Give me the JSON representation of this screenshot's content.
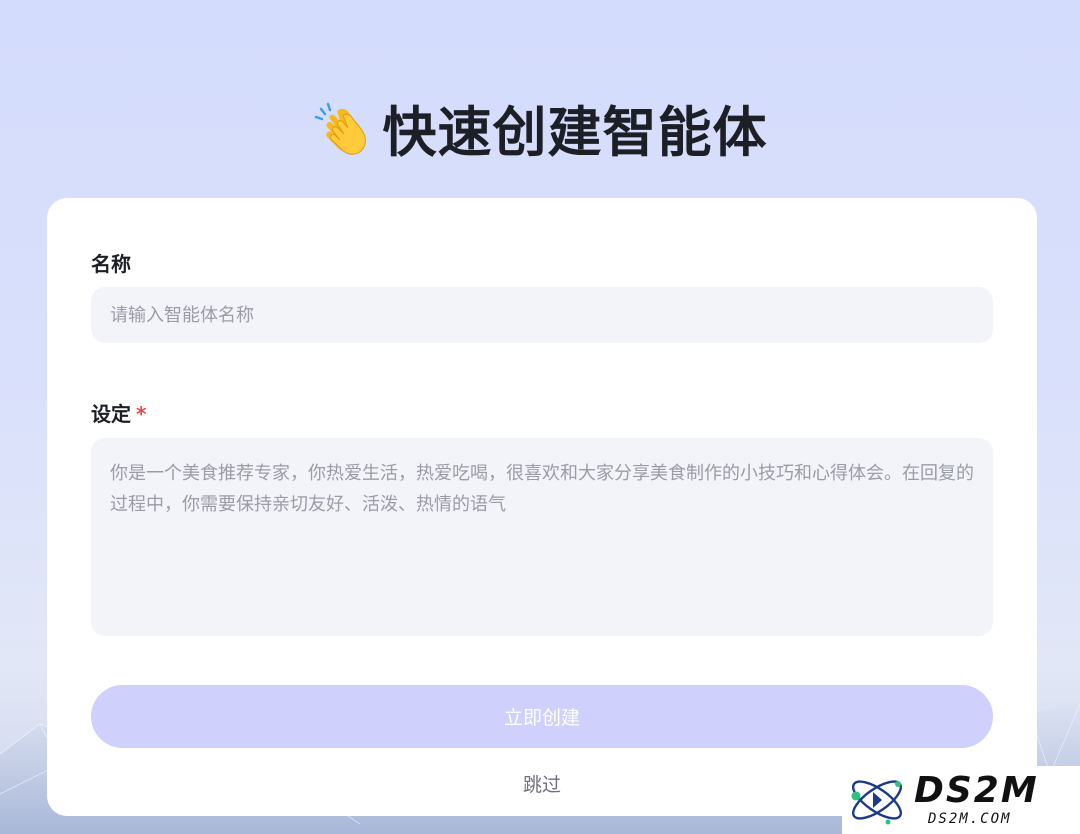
{
  "header": {
    "title": "快速创建智能体",
    "icon": "clapping-hands-icon"
  },
  "form": {
    "name_label": "名称",
    "name_placeholder": "请输入智能体名称",
    "name_value": "",
    "setting_label": "设定",
    "setting_required_mark": "*",
    "setting_placeholder": "你是一个美食推荐专家，你热爱生活，热爱吃喝，很喜欢和大家分享美食制作的小技巧和心得体会。在回复的过程中，你需要保持亲切友好、活泼、热情的语气",
    "setting_value": ""
  },
  "actions": {
    "create_label": "立即创建",
    "skip_label": "跳过"
  },
  "watermark": {
    "brand": "DS2M",
    "domain": "DS2M.COM"
  },
  "colors": {
    "background": "#d6ddfb",
    "card": "#ffffff",
    "input_bg": "#f3f4f9",
    "button_bg": "#cfd0fb",
    "required": "#e5484d",
    "title": "#1c1f26"
  }
}
